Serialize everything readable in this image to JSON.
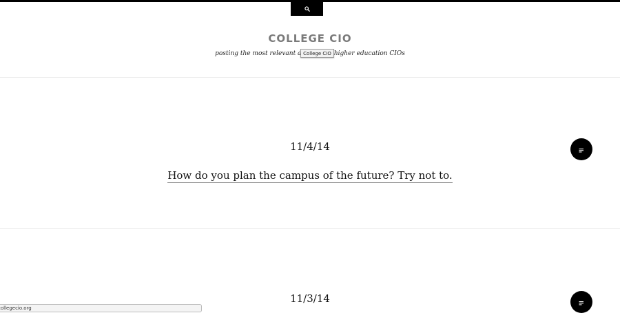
{
  "header": {
    "site_title": "COLLEGE CIO",
    "tagline": "posting the most relevant articles for higher education CIOs",
    "search_icon": "search-icon"
  },
  "tooltip": {
    "text": "College CIO"
  },
  "posts": [
    {
      "date": "11/4/14",
      "title": "How do you plan the campus of the future? Try not to.",
      "format_icon": "standard-post-icon"
    },
    {
      "date": "11/3/14",
      "title": "",
      "format_icon": "standard-post-icon"
    }
  ],
  "status_bar": {
    "url": "collegecio.org"
  },
  "colors": {
    "accent": "#000000",
    "title_gray": "#7a7a7a",
    "divider": "#ececec"
  }
}
